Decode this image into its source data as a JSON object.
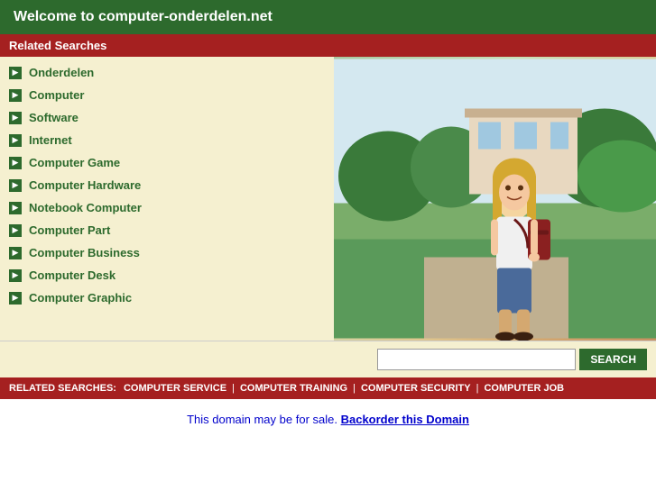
{
  "header": {
    "title": "Welcome to computer-onderdelen.net"
  },
  "related_searches_bar": {
    "label": "Related Searches"
  },
  "links": [
    {
      "text": "Onderdelen"
    },
    {
      "text": "Computer"
    },
    {
      "text": "Software"
    },
    {
      "text": "Internet"
    },
    {
      "text": "Computer Game"
    },
    {
      "text": "Computer Hardware"
    },
    {
      "text": "Notebook Computer"
    },
    {
      "text": "Computer Part"
    },
    {
      "text": "Computer Business"
    },
    {
      "text": "Computer Desk"
    },
    {
      "text": "Computer Graphic"
    }
  ],
  "search": {
    "placeholder": "",
    "button_label": "SEARCH"
  },
  "bottom_bar": {
    "label": "RELATED SEARCHES:",
    "links": [
      "COMPUTER SERVICE",
      "COMPUTER TRAINING",
      "COMPUTER SECURITY",
      "COMPUTER JOB"
    ]
  },
  "footer": {
    "static_text": "This domain may be for sale.",
    "link_text": "Backorder this Domain"
  }
}
